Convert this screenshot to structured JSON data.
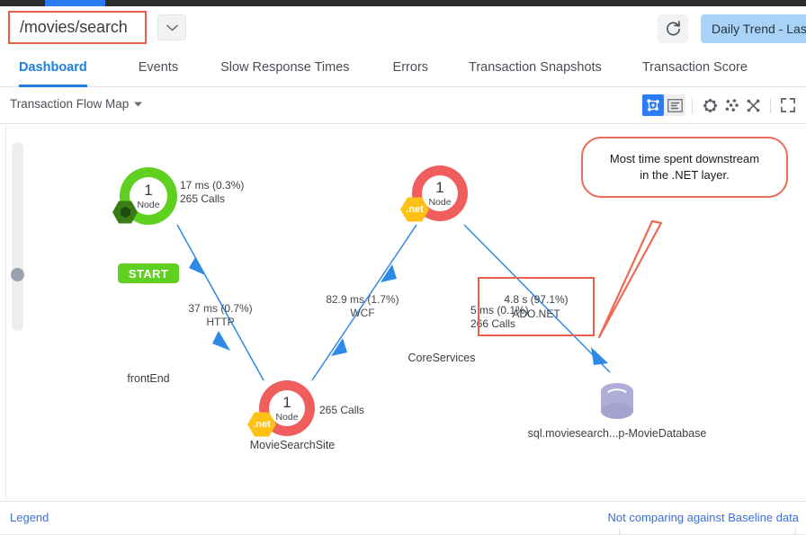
{
  "browser": {
    "active_tab_color": "#2b7cf7",
    "strip_color": "#2d2d2d"
  },
  "header": {
    "business_transaction": "/movies/search",
    "dropdown_icon": "chevron-down-icon",
    "refresh_icon": "refresh-icon",
    "time_range_label": "Daily Trend - Las",
    "time_range_color": "#a8d3f7",
    "highlight_color": "#e8604c"
  },
  "tabs": [
    {
      "label": "Dashboard",
      "active": true
    },
    {
      "label": "Events",
      "active": false
    },
    {
      "label": "Slow Response Times",
      "active": false
    },
    {
      "label": "Errors",
      "active": false
    },
    {
      "label": "Transaction Snapshots",
      "active": false
    },
    {
      "label": "Transaction Score",
      "active": false
    }
  ],
  "subtoolbar": {
    "view_select_label": "Transaction Flow Map",
    "view_select_caret": "caret-down-icon",
    "icons": [
      {
        "name": "flow-map-view-icon",
        "active": true
      },
      {
        "name": "list-view-icon",
        "active": false
      },
      {
        "name": "circular-layout-icon",
        "active": false
      },
      {
        "name": "scatter-layout-icon",
        "active": false
      },
      {
        "name": "cross-layout-icon",
        "active": false
      },
      {
        "name": "fullscreen-icon",
        "active": false
      }
    ]
  },
  "canvas": {
    "zoom_slider": {
      "name": "zoom-slider",
      "value_position_pct": 67
    },
    "nodes": [
      {
        "id": "frontEnd",
        "label": "frontEnd",
        "count": "1",
        "count_sub": "Node",
        "ring_color": "#5fd020",
        "badge_text": "",
        "badge_color": "#3a7d18",
        "badge_type": "nodejs-icon",
        "metric_line1": "17 ms (0.3%)",
        "metric_line2": "265 Calls",
        "start_badge": "START"
      },
      {
        "id": "CoreServices",
        "label": "CoreServices",
        "count": "1",
        "count_sub": "Node",
        "ring_color": "#ef5d5d",
        "badge_text": ".net",
        "badge_color": "#ffc114",
        "badge_type": "dotnet-icon",
        "metric_line1": "5 ms (0.1%)",
        "metric_line2": "266 Calls",
        "start_badge": ""
      },
      {
        "id": "MovieSearchSite",
        "label": "MovieSearchSite",
        "count": "1",
        "count_sub": "Node",
        "ring_color": "#ef5d5d",
        "badge_text": ".net",
        "badge_color": "#ffc114",
        "badge_type": "dotnet-icon",
        "metric_line1": "265 Calls",
        "metric_line2": "",
        "start_badge": ""
      },
      {
        "id": "database",
        "label": "sql.moviesearch...p-MovieDatabase",
        "count": "",
        "count_sub": "",
        "ring_color": "#b0aed8",
        "badge_text": "",
        "badge_color": "",
        "badge_type": "database-icon",
        "metric_line1": "",
        "metric_line2": "",
        "start_badge": ""
      }
    ],
    "edges": [
      {
        "from": "frontEnd",
        "to": "MovieSearchSite",
        "line1": "37 ms (0.7%)",
        "line2": "HTTP"
      },
      {
        "from": "MovieSearchSite",
        "to": "CoreServices",
        "line1": "82.9 ms (1.7%)",
        "line2": "WCF"
      },
      {
        "from": "CoreServices",
        "to": "database",
        "line1": "4.8 s (97.1%)",
        "line2": "ADO.NET"
      }
    ],
    "highlight_box": {
      "line1": "4.8 s (97.1%)",
      "line2": "ADO.NET",
      "border_color": "#e8604c"
    },
    "callout": {
      "line1": "Most time spent downstream",
      "line2": "in the .NET layer.",
      "border_color": "#ec6a57"
    },
    "edge_color": "#2e8ae5"
  },
  "footer": {
    "legend_label": "Legend",
    "baseline_label": "Not comparing against Baseline data",
    "link_color": "#3d6fd8"
  }
}
